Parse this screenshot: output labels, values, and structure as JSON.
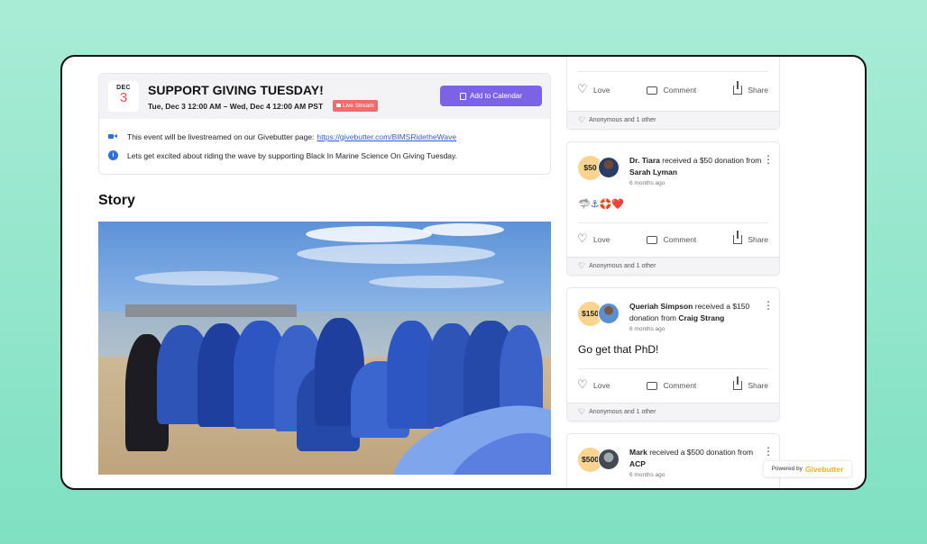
{
  "event": {
    "month": "DEC",
    "day": "3",
    "title": "SUPPORT GIVING TUESDAY!",
    "time": "Tue, Dec 3 12:00 AM – Wed, Dec 4 12:00 AM PST",
    "live_badge": "Live Stream",
    "calendar_button": "Add to Calendar",
    "livestream_text": "This event will be livestreamed on our Givebutter page:",
    "livestream_link": "https://givebutter.com/BIMSRidetheWave",
    "description": "Lets get excited about riding the wave by supporting Black In Marine Science On Giving Tuesday."
  },
  "story": {
    "title": "Story"
  },
  "actions": {
    "love": "Love",
    "comment": "Comment",
    "share": "Share"
  },
  "feed": [
    {
      "footer": "Anonymous and 1 other"
    },
    {
      "amount": "$50",
      "recipient": "Dr. Tiara",
      "received_text": "received a $50 donation from",
      "donor": "Sarah Lyman",
      "time_ago": "6 months ago",
      "message": "🦈⚓🛟❤️",
      "footer": "Anonymous and 1 other"
    },
    {
      "amount": "$150",
      "recipient": "Queriah Simpson",
      "received_text": "received a $150 donation from",
      "donor": "Craig Strang",
      "time_ago": "6 months ago",
      "message": "Go get that PhD!",
      "footer": "Anonymous and 1 other"
    },
    {
      "amount": "$500",
      "recipient": "Mark",
      "received_text": "received a $500 donation from",
      "donor": "ACP",
      "time_ago": "6 months ago"
    }
  ],
  "powered_by": {
    "label": "Powered by",
    "brand": "Givebutter"
  },
  "colors": {
    "accent": "#7c63e6",
    "live": "#f26b6b",
    "amount_bg": "#f8d48f",
    "brand": "#f2b21b",
    "background": "#8fe4c7"
  }
}
